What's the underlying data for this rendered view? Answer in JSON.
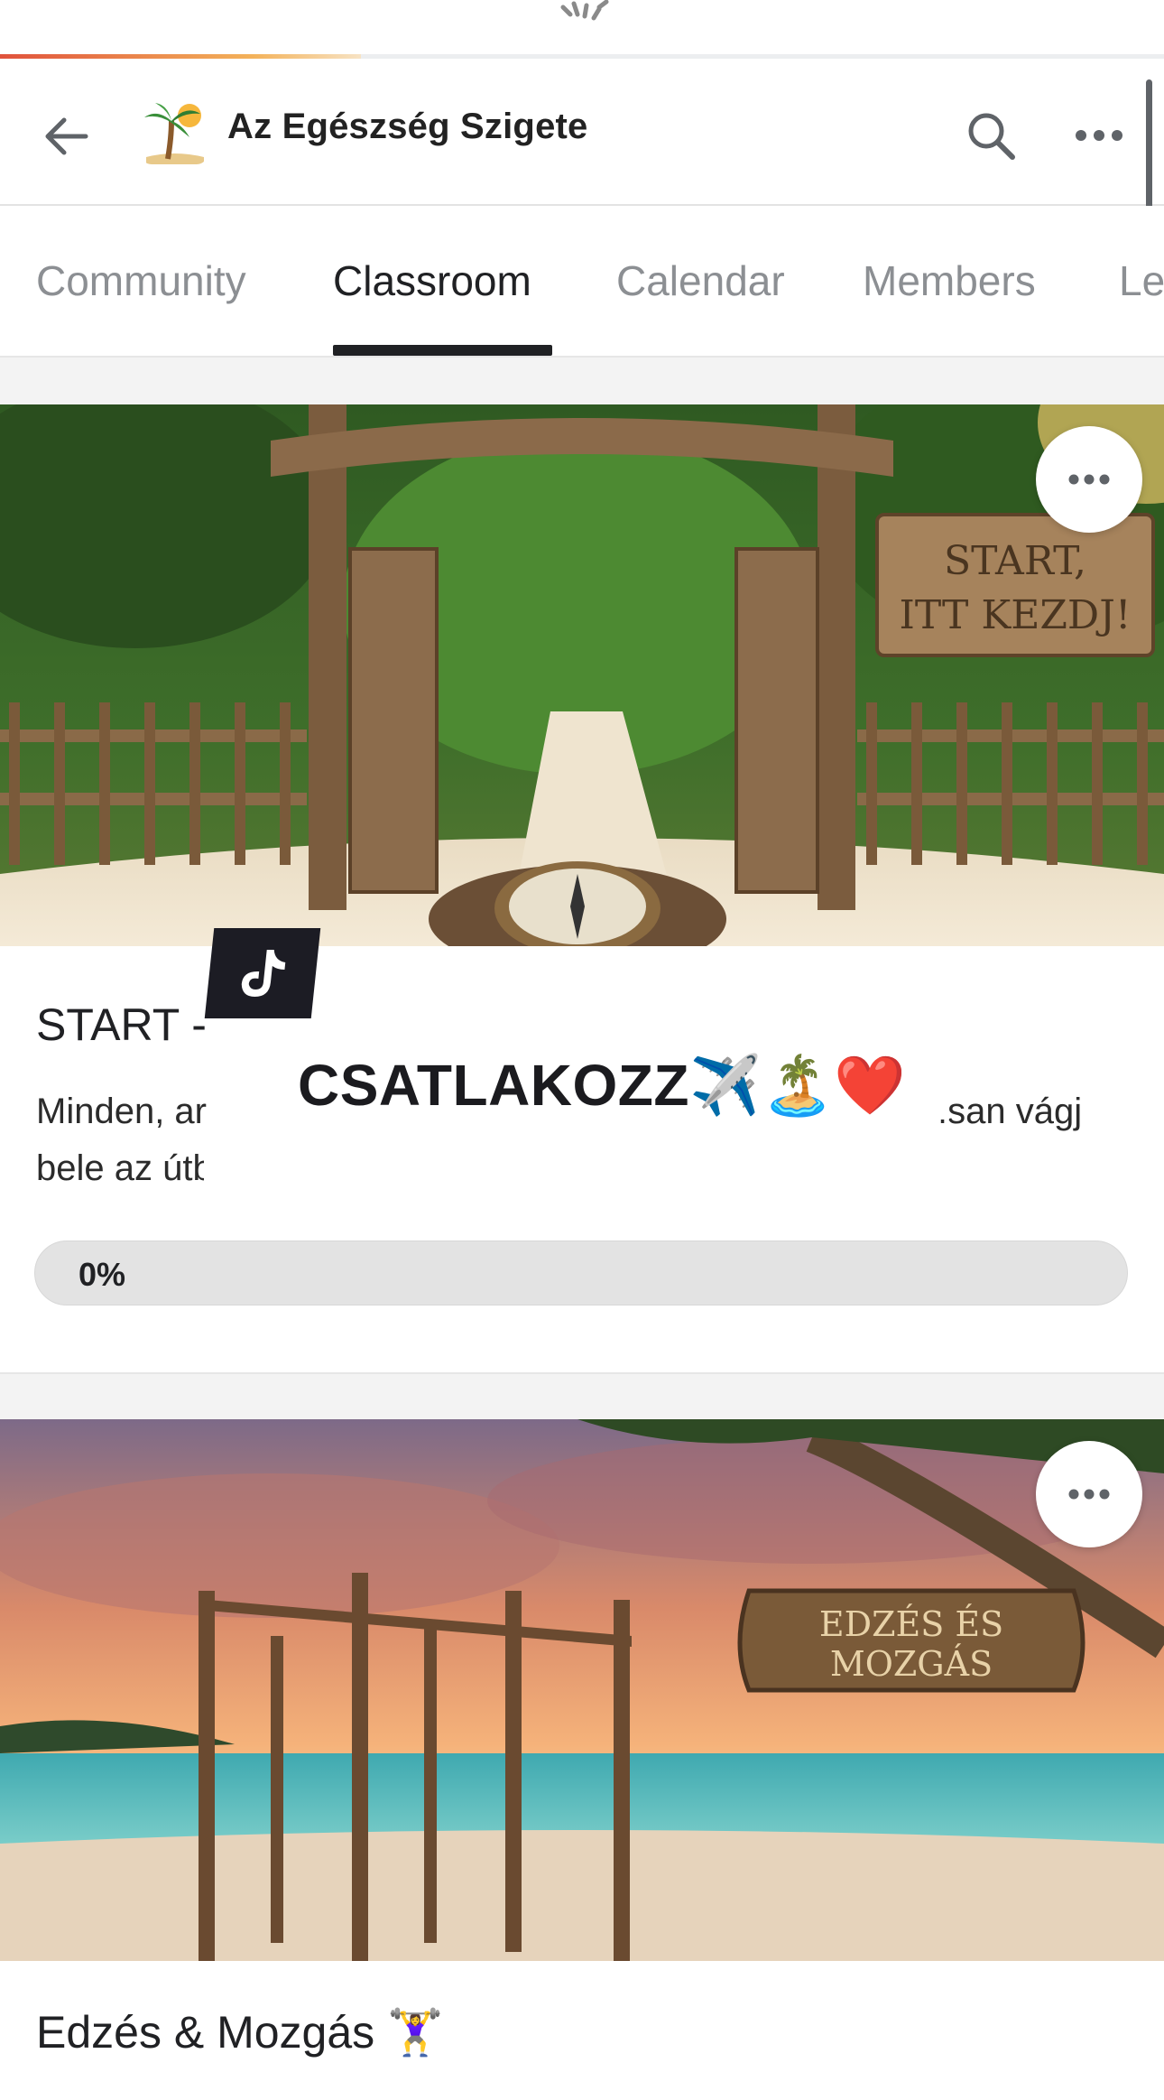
{
  "group": {
    "name": "Az Egészség Szigete"
  },
  "tabs": [
    {
      "label": "Community",
      "active": false
    },
    {
      "label": "Classroom",
      "active": true
    },
    {
      "label": "Calendar",
      "active": false
    },
    {
      "label": "Members",
      "active": false
    },
    {
      "label": "Le",
      "active": false
    }
  ],
  "courses": [
    {
      "title": "START -",
      "description_line1_left": "Minden, ar",
      "description_line1_right": "ısan vágj",
      "description_line2": "bele az útbu.",
      "progress_label": "0%",
      "progress_value": 0,
      "image_sign_text": "START, ITT KEZDJ!"
    },
    {
      "title": "Edzés & Mozgás 🏋️‍♀️",
      "image_sign_text": "EDZÉS ÉS MOZGÁS"
    }
  ],
  "overlay": {
    "caption": "CSATLAKOZZ✈️🏝️❤️",
    "logo_icon": "tiktok-icon"
  },
  "colors": {
    "accent": "#202124",
    "progress_track": "#e3e3e3",
    "loader_gradient_start": "#e0523c",
    "loader_gradient_end": "#f3b25a"
  }
}
